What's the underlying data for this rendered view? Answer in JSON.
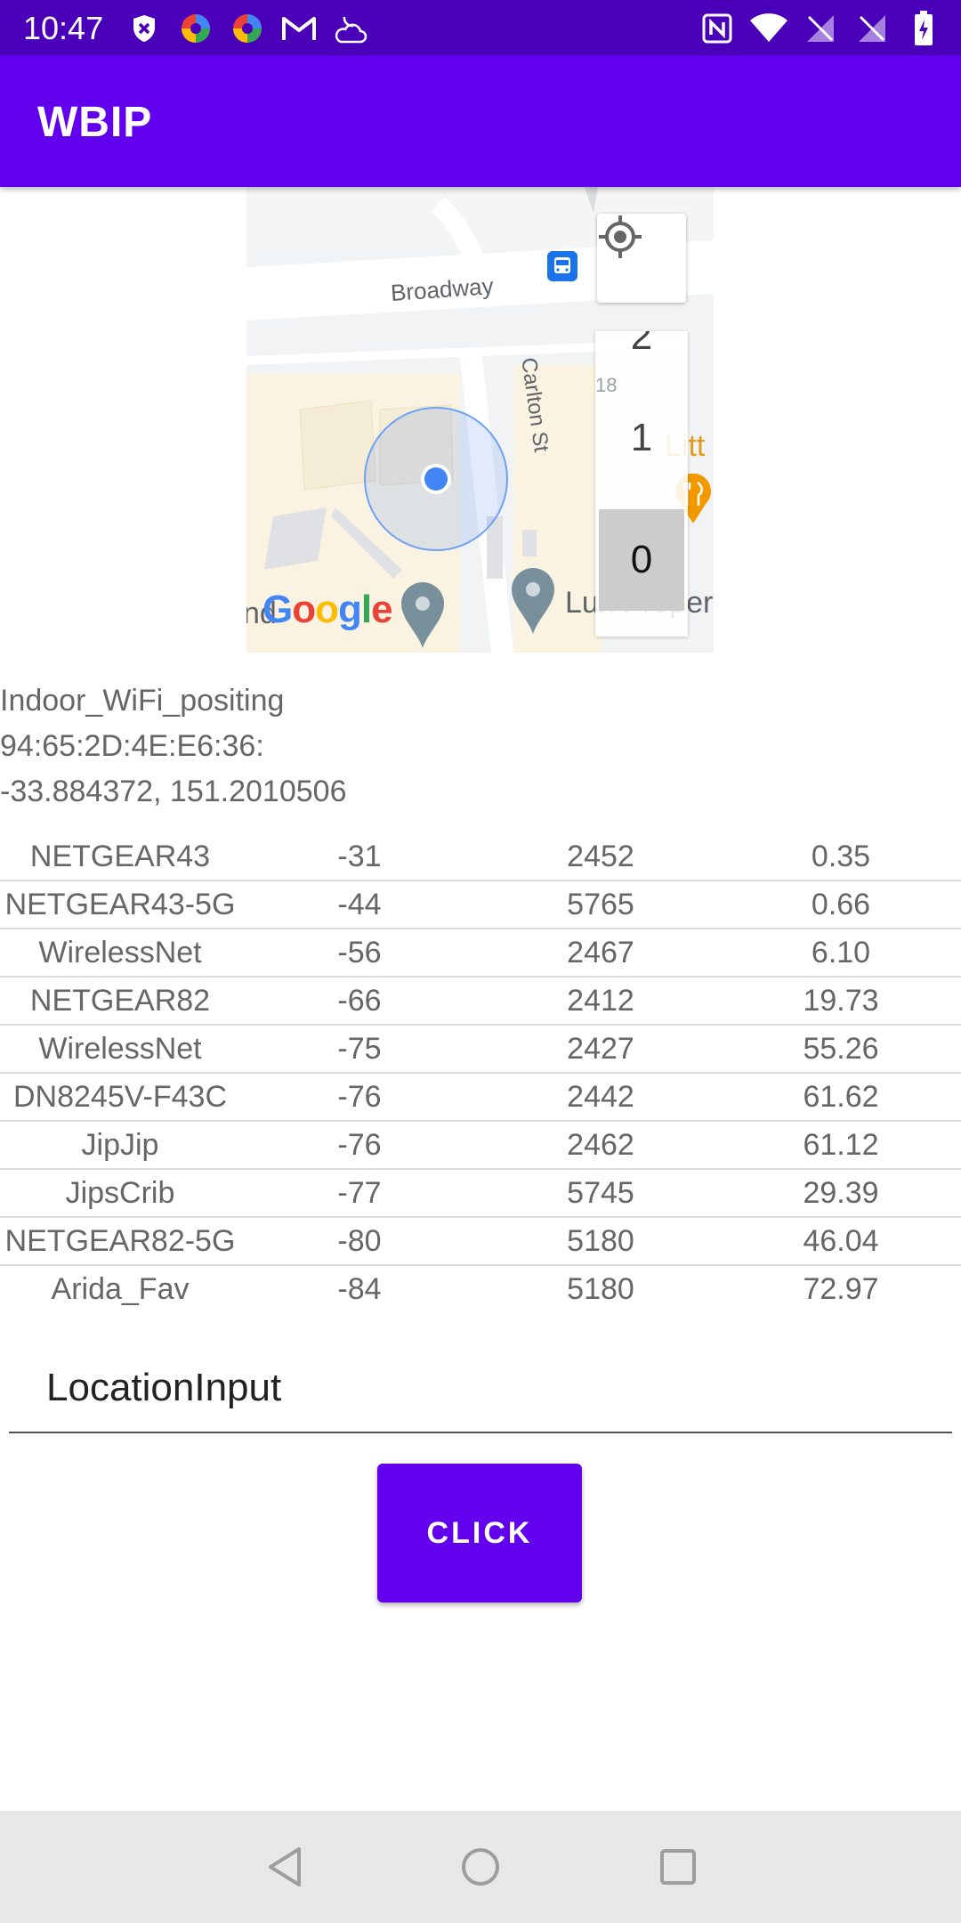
{
  "status_bar": {
    "time": "10:47",
    "left_icons": [
      "shield-icon",
      "pinwheel-icon",
      "pinwheel-icon",
      "gmail-icon",
      "partly-cloudy-night-icon"
    ],
    "right_icons": [
      "nfc-icon",
      "wifi-icon",
      "no-signal-icon",
      "no-signal-icon",
      "battery-charging-icon"
    ],
    "color": "#4a00b8"
  },
  "app_bar": {
    "title": "WBIP",
    "color": "#6200ee"
  },
  "map": {
    "labels": {
      "broadway": "Broadway",
      "carlton": "Carlton St",
      "litt": "Litt",
      "lux": "Lux Proper",
      "nd": "nd"
    },
    "level_picker": {
      "levels": [
        "2",
        "1",
        "0"
      ],
      "selected": "0",
      "hint": "18"
    },
    "google_logo": "Google",
    "icons": [
      "my-location-icon",
      "bus-stop-icon",
      "restaurant-icon",
      "place-marker-icon",
      "place-marker-icon"
    ]
  },
  "info": {
    "ssid": "Indoor_WiFi_positing",
    "bssid": "94:65:2D:4E:E6:36:",
    "coords": "-33.884372, 151.2010506"
  },
  "wifi_table": {
    "rows": [
      {
        "ssid": "NETGEAR43",
        "rssi": "-31",
        "freq": "2452",
        "dist": "0.35"
      },
      {
        "ssid": "NETGEAR43-5G",
        "rssi": "-44",
        "freq": "5765",
        "dist": "0.66"
      },
      {
        "ssid": "WirelessNet",
        "rssi": "-56",
        "freq": "2467",
        "dist": "6.10"
      },
      {
        "ssid": "NETGEAR82",
        "rssi": "-66",
        "freq": "2412",
        "dist": "19.73"
      },
      {
        "ssid": "WirelessNet",
        "rssi": "-75",
        "freq": "2427",
        "dist": "55.26"
      },
      {
        "ssid": "DN8245V-F43C",
        "rssi": "-76",
        "freq": "2442",
        "dist": "61.62"
      },
      {
        "ssid": "JipJip",
        "rssi": "-76",
        "freq": "2462",
        "dist": "61.12"
      },
      {
        "ssid": "JipsCrib",
        "rssi": "-77",
        "freq": "5745",
        "dist": "29.39"
      },
      {
        "ssid": "NETGEAR82-5G",
        "rssi": "-80",
        "freq": "5180",
        "dist": "46.04"
      },
      {
        "ssid": "Arida_Fav",
        "rssi": "-84",
        "freq": "5180",
        "dist": "72.97"
      }
    ]
  },
  "location_input": {
    "placeholder": "LocationInput",
    "value": ""
  },
  "click_button": {
    "label": "CLICK"
  },
  "nav_bar": {
    "icons": [
      "back-icon",
      "home-icon",
      "recents-icon"
    ]
  }
}
